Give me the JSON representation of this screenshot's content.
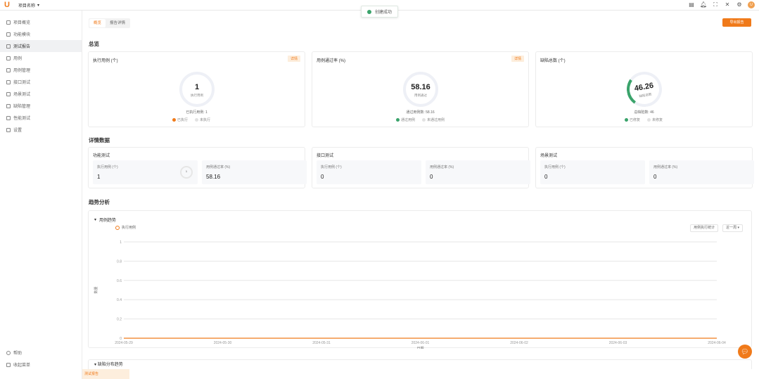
{
  "topbar": {
    "logo": "U",
    "project_name": "项目名称",
    "icons": [
      "doc-icon",
      "bell-icon",
      "expand-icon",
      "close-icon",
      "gear-icon"
    ],
    "avatar": "U"
  },
  "toast": {
    "message": "创建成功"
  },
  "sidebar": {
    "items": [
      {
        "label": "项目概览",
        "icon": "home-icon"
      },
      {
        "label": "功能模块",
        "icon": "module-icon"
      },
      {
        "label": "测试报告",
        "icon": "report-icon",
        "active": true
      },
      {
        "label": "用例",
        "icon": "user-icon"
      },
      {
        "label": "用例管理",
        "icon": "case-icon"
      },
      {
        "label": "接口测试",
        "icon": "api-icon"
      },
      {
        "label": "场景测试",
        "icon": "scene-icon"
      },
      {
        "label": "缺陷管理",
        "icon": "bug-icon"
      },
      {
        "label": "性能测试",
        "icon": "perf-icon"
      },
      {
        "label": "设置",
        "icon": "settings-icon"
      }
    ],
    "bottom": [
      "帮助",
      "收起菜单"
    ]
  },
  "tabs": [
    "概览",
    "报告详情"
  ],
  "header_button": "导出报告",
  "summary_title": "总览",
  "cards": [
    {
      "title": "执行用例 (个)",
      "tag": "详情",
      "value": "1",
      "value_label": "执行用例",
      "sub": "已执行用例: 1",
      "legend": [
        "已执行",
        "未执行"
      ],
      "accent": "#f07a1a"
    },
    {
      "title": "用例通过率 (%)",
      "tag": "详情",
      "value": "58.16",
      "value_label": "用例通过",
      "sub": "通过用例数: 58.16",
      "legend": [
        "通过用例",
        "未通过用例"
      ],
      "accent": "#3aa36b"
    },
    {
      "title": "缺陷总数 (个)",
      "tag": "",
      "value": "46.26",
      "value_label": "缺陷总数",
      "sub": "总缺陷数: 46",
      "legend": [
        "已修复",
        "未修复"
      ],
      "accent": "#3aa36b"
    }
  ],
  "details_title": "详情数据",
  "details": [
    {
      "title": "功能测试",
      "boxes": [
        {
          "label": "执行用例 (个)",
          "value": "1"
        },
        {
          "label": "用例通过率 (%)",
          "value": "58.16"
        }
      ],
      "mini_ring": "1"
    },
    {
      "title": "接口测试",
      "boxes": [
        {
          "label": "执行用例 (个)",
          "value": "0"
        },
        {
          "label": "用例通过率 (%)",
          "value": "0"
        }
      ]
    },
    {
      "title": "场景测试",
      "boxes": [
        {
          "label": "执行用例 (个)",
          "value": "0"
        },
        {
          "label": "用例通过率 (%)",
          "value": "0"
        }
      ]
    }
  ],
  "trend_title": "趋势分析",
  "trend": {
    "header": "用例趋势",
    "legend": "执行用例",
    "selects": [
      "用例执行统计",
      "近一周"
    ],
    "collapse_label": "缺陷分布趋势"
  },
  "chart_data": {
    "type": "line",
    "x": [
      "2024-05-29",
      "2024-05-30",
      "2024-05-31",
      "2024-06-01",
      "2024-06-02",
      "2024-06-03",
      "2024-06-04"
    ],
    "series": [
      {
        "name": "执行用例",
        "values": [
          0,
          0,
          0,
          0,
          0,
          0,
          0
        ]
      }
    ],
    "yticks": [
      "0",
      "0.2",
      "0.4",
      "0.6",
      "0.8",
      "1"
    ],
    "ylabel": "数量",
    "xlabel": "日期",
    "ylim": [
      0,
      1
    ],
    "color": "#f07a1a"
  },
  "bottom_tag": "测试报告",
  "chat_icon": "chat-icon"
}
